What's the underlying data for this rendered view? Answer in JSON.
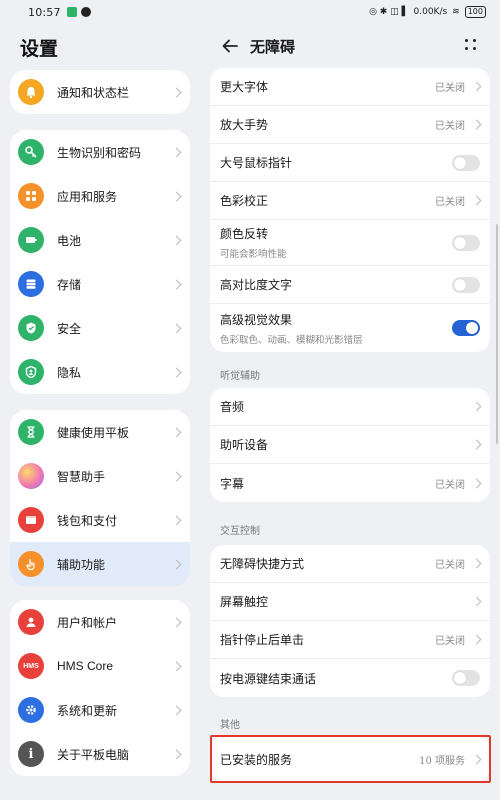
{
  "status_bar": {
    "time": "10:57",
    "right_text": "0.00K/s",
    "battery": "100"
  },
  "left": {
    "title": "设置",
    "groups": [
      [
        {
          "label": "通知和状态栏",
          "icon": "bell-icon",
          "color": "#f5a623"
        }
      ],
      [
        {
          "label": "生物识别和密码",
          "icon": "key-icon",
          "color": "#2fb36b"
        },
        {
          "label": "应用和服务",
          "icon": "apps-icon",
          "color": "#f5902a"
        },
        {
          "label": "电池",
          "icon": "battery-icon",
          "color": "#2fb36b"
        },
        {
          "label": "存储",
          "icon": "storage-icon",
          "color": "#2d6ee0"
        },
        {
          "label": "安全",
          "icon": "shield-icon",
          "color": "#2fb36b"
        },
        {
          "label": "隐私",
          "icon": "privacy-icon",
          "color": "#2fb36b"
        }
      ],
      [
        {
          "label": "健康使用平板",
          "icon": "hourglass-icon",
          "color": "#2fb36b"
        },
        {
          "label": "智慧助手",
          "icon": "assistant-icon",
          "color": "#b06ce0"
        },
        {
          "label": "钱包和支付",
          "icon": "wallet-icon",
          "color": "#e8403a"
        },
        {
          "label": "辅助功能",
          "icon": "hand-icon",
          "color": "#f5902a",
          "selected": true
        }
      ],
      [
        {
          "label": "用户和帐户",
          "icon": "user-icon",
          "color": "#e8403a"
        },
        {
          "label": "HMS Core",
          "icon": "hms-icon",
          "color": "#e8403a"
        },
        {
          "label": "系统和更新",
          "icon": "gear-icon",
          "color": "#2d6ee0"
        },
        {
          "label": "关于平板电脑",
          "icon": "info-icon",
          "color": "#555555"
        }
      ]
    ]
  },
  "right": {
    "title": "无障碍",
    "vision_items": [
      {
        "label": "更大字体",
        "value": "已关闭",
        "type": "value"
      },
      {
        "label": "放大手势",
        "value": "已关闭",
        "type": "value"
      },
      {
        "label": "大号鼠标指针",
        "type": "toggle",
        "on": false
      },
      {
        "label": "色彩校正",
        "value": "已关闭",
        "type": "value"
      },
      {
        "label": "颜色反转",
        "sub": "可能会影响性能",
        "type": "toggle",
        "on": false
      },
      {
        "label": "高对比度文字",
        "type": "toggle",
        "on": false
      },
      {
        "label": "高级视觉效果",
        "sub": "色彩取色、动画、模糊和光影错层",
        "type": "toggle",
        "on": true
      }
    ],
    "hearing_label": "听觉辅助",
    "hearing_items": [
      {
        "label": "音频",
        "type": "chevron"
      },
      {
        "label": "助听设备",
        "type": "chevron"
      },
      {
        "label": "字幕",
        "value": "已关闭",
        "type": "value"
      }
    ],
    "interaction_label": "交互控制",
    "interaction_items": [
      {
        "label": "无障碍快捷方式",
        "value": "已关闭",
        "type": "value"
      },
      {
        "label": "屏幕触控",
        "type": "chevron"
      },
      {
        "label": "指针停止后单击",
        "value": "已关闭",
        "type": "value"
      },
      {
        "label": "按电源键结束通话",
        "type": "toggle",
        "on": false
      }
    ],
    "other_label": "其他",
    "other_items": [
      {
        "label": "已安装的服务",
        "value": "10 项服务",
        "type": "value"
      }
    ]
  },
  "colors": {
    "accent": "#2563d4",
    "highlight": "#e23a2a"
  }
}
